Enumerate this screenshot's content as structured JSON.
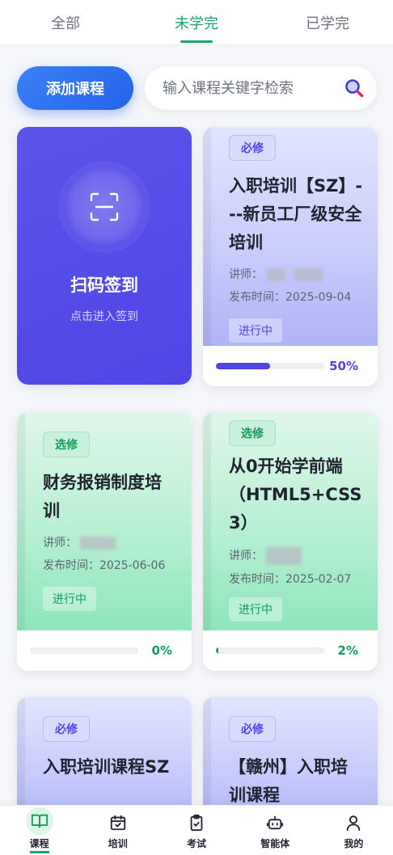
{
  "tabs": [
    {
      "label": "全部"
    },
    {
      "label": "未学完"
    },
    {
      "label": "已学完"
    }
  ],
  "toolbar": {
    "add_label": "添加课程",
    "search_placeholder": "输入课程关键字检索"
  },
  "scan_card": {
    "title": "扫码签到",
    "subtitle": "点击进入签到"
  },
  "labels": {
    "teacher": "讲师：",
    "publish": "发布时间："
  },
  "courses": [
    {
      "badge": "必修",
      "title": "入职培训【SZ】---新员工厂级安全培训",
      "date": "2025-09-04",
      "status": "进行中",
      "progress": 50,
      "progress_label": "50%",
      "theme": "purple"
    },
    {
      "badge": "选修",
      "title": "财务报销制度培训",
      "date": "2025-06-06",
      "status": "进行中",
      "progress": 0,
      "progress_label": "0%",
      "theme": "green"
    },
    {
      "badge": "选修",
      "title": "从0开始学前端（HTML5+CSS3）",
      "date": "2025-02-07",
      "status": "进行中",
      "progress": 2,
      "progress_label": "2%",
      "theme": "green"
    },
    {
      "badge": "必修",
      "title": "入职培训课程SZ",
      "theme": "purple"
    },
    {
      "badge": "必修",
      "title": "【赣州】入职培训课程",
      "theme": "purple"
    }
  ],
  "bottom_nav": [
    {
      "label": "课程",
      "icon": "book-icon"
    },
    {
      "label": "培训",
      "icon": "calendar-check-icon"
    },
    {
      "label": "考试",
      "icon": "clipboard-check-icon"
    },
    {
      "label": "智能体",
      "icon": "robot-icon"
    },
    {
      "label": "我的",
      "icon": "user-icon"
    }
  ],
  "colors": {
    "accent": "#22a06b",
    "primary": "#2563eb",
    "indigo": "#4f46e5"
  }
}
